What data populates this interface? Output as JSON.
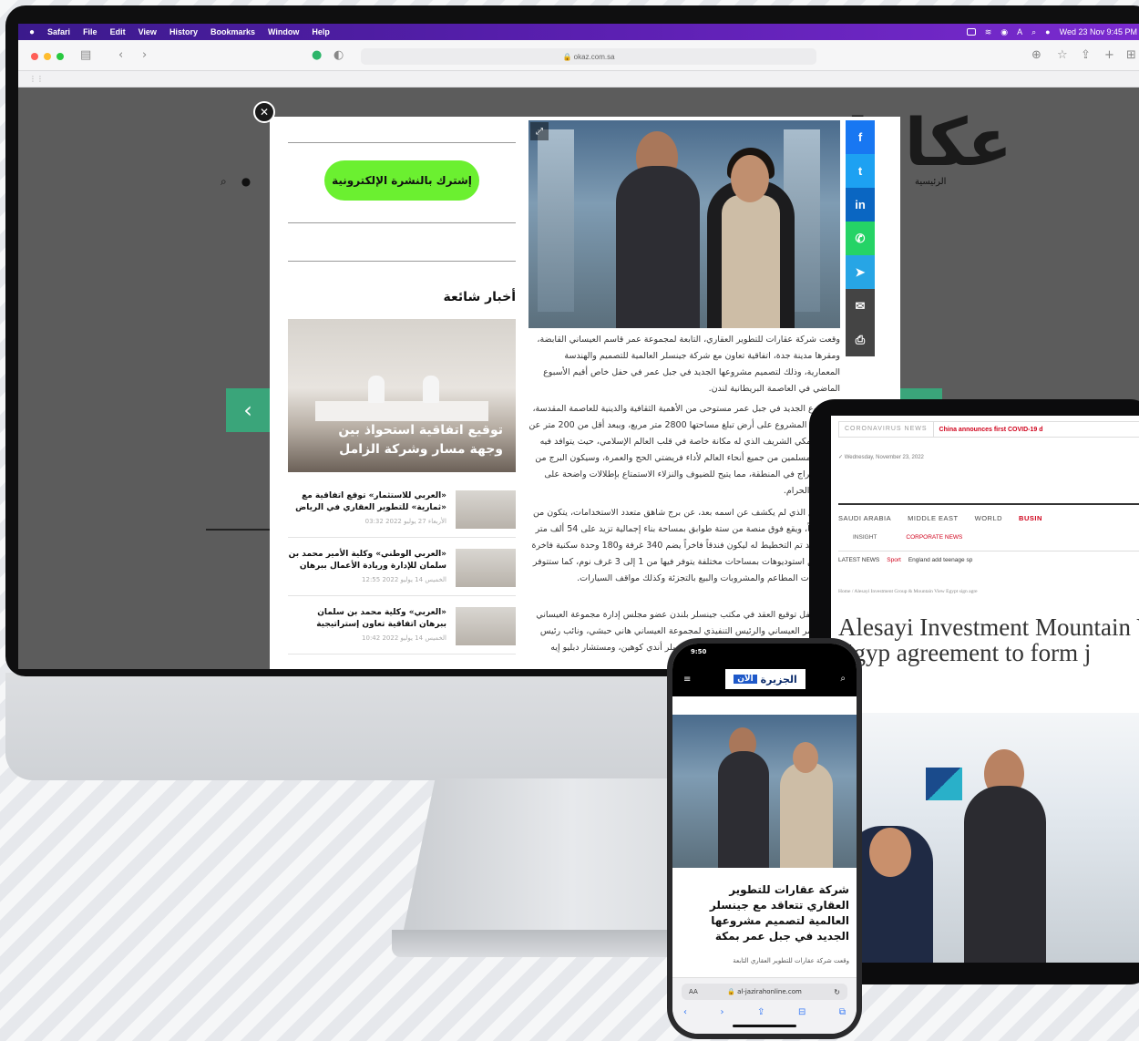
{
  "menubar": {
    "apple": "",
    "items": [
      "Safari",
      "File",
      "Edit",
      "View",
      "History",
      "Bookmarks",
      "Window",
      "Help"
    ],
    "clock": "Wed 23 Nov 9:45 PM"
  },
  "browser": {
    "url": "okaz.com.sa"
  },
  "okaz": {
    "logo": "عكاظ",
    "nav_home": "الرئيسية"
  },
  "modal": {
    "subscribe_label": "إشترك بالنشرة الإلكترونية",
    "trending_title": "أخبار شائعة",
    "featured_caption": "توقيع اتفاقية استحواذ بين وجهة مسار وشركة الزامل",
    "news": [
      {
        "title": "«العربي للاستثمار» توقع اتفاقية مع «ثمارية» للتطوير العقاري في الرياض",
        "date": "الأربعاء 27 يوليو 2022 03:32"
      },
      {
        "title": "«العربي الوطني» وكلية الأمير محمد بن سلمان للإدارة وريادة الأعمال ببرهان",
        "date": "الخميس 14 يوليو 2022 12:55"
      },
      {
        "title": "«العربي» وكلية محمد بن سلمان ببرهان اتفاقية تعاون إستراتيجية",
        "date": "الخميس 14 يوليو 2022 10:42"
      }
    ],
    "paragraphs": [
      "وقعت شركة عقارات للتطوير العقاري، التابعة لمجموعة عمر قاسم العيساني القابضة، ومقرها مدينة جدة، اتفاقية تعاون مع شركة جينسلر العالمية للتصميم والهندسة المعمارية، وذلك لتصميم مشروعها الجديد في جبل عمر في حفل خاص أقيم الأسبوع الماضي في العاصمة البريطانية لندن.",
      "المشروع الجديد في جبل عمر مستوحى من الأهمية الثقافية والدينية للعاصمة المقدسة، حيث يقع المشروع على أرض تبلغ مساحتها 2800 متر مربع، ويبعد أقل من 200 متر عن الحرم المكي الشريف الذي له مكانة خاصة في قلب العالم الإسلامي، حيث يتوافد فيه ملايين المسلمين من جميع أنحاء العالم لأداء فريضتي الحج والعمرة، وسيكون البرج من أعلى الأبراج في المنطقة، مما يتيح للضيوف والنزلاء الاستمتاع بإطلالات واضحة على المسجد الحرام.",
      "المشروع الذي لم يكشف عن اسمه بعد، عن برج شاهق متعدد الاستخدامات، يتكون من 35 طابقاً، ويقع فوق منصة من ستة طوابق بمساحة بناء إجمالية تزيد على 54 ألف متر مربع، وقد تم التخطيط له ليكون فندقاً فاخراً يضم 340 غرفة و180 وحدة سكنية فاخرة مؤثثة من استوديوهات بمساحات مختلفة يتوفر فيها من 1 إلى 3 غرف نوم، كما ستتوفر فيه خدمات المطاعم والمشروبات والبيع بالتجزئة وكذلك مواقف السيارات.",
      "وحضر حفل توقيع العقد في مكتب جينسلر بلندن عضو مجلس إدارة مجموعة العيساني محمد عمر العيساني والرئيس التنفيذي لمجموعة العيساني هاني حبشي، ونائب رئيس جينسلر جانم العيساني والرئيس التنفيذي لجينسلر أندي كوهين، ومستشار دبليو إيه وشركاؤه."
    ],
    "share": [
      {
        "icon": "facebook-icon",
        "glyph": "f",
        "color": "#1877f2"
      },
      {
        "icon": "twitter-icon",
        "glyph": "t",
        "color": "#1da1f2"
      },
      {
        "icon": "linkedin-icon",
        "glyph": "in",
        "color": "#0a66c2"
      },
      {
        "icon": "whatsapp-icon",
        "glyph": "✆",
        "color": "#25d366"
      },
      {
        "icon": "telegram-icon",
        "glyph": "➤",
        "color": "#27a5e5"
      },
      {
        "icon": "email-icon",
        "glyph": "✉",
        "color": "#444444"
      },
      {
        "icon": "print-icon",
        "glyph": "⎙",
        "color": "#444444"
      }
    ]
  },
  "tablet": {
    "ticker_label": "CORONAVIRUS NEWS",
    "ticker_text": "China announces first COVID-19 d",
    "date": "Wednesday, November 23, 2022",
    "nav": [
      "SAUDI ARABIA",
      "MIDDLE EAST",
      "WORLD",
      "BUSIN"
    ],
    "sub": [
      "INSIGHT",
      "CORPORATE NEWS"
    ],
    "latest_label": "LATEST NEWS",
    "latest_cat": "Sport",
    "latest_text": "England add teenage sp",
    "breadcrumb": "Home / Alesayi Investment Group & Mountain View Egypt sign agre",
    "headline": "Alesayi Investment Mountain View Egyp agreement to form j"
  },
  "phone": {
    "time": "9:50",
    "logo": "الجزيرة",
    "logo_badge": "الآن",
    "title": "شركة عقارات للتطوير العقاري تتعاقد مع جينسلر العالمية لتصميم مشروعها الجديد في جبل عمر بمكة",
    "excerpt": "وقعت شركة عقارات للتطوير العقاري التابعة",
    "url": "al-jazirahonline.com",
    "aa": "AA"
  },
  "colors": {
    "accent_green": "#3aa57a",
    "subscribe_green": "#6bf030",
    "menubar_purple": "#5a1fb0",
    "news_red": "#d0021b"
  }
}
